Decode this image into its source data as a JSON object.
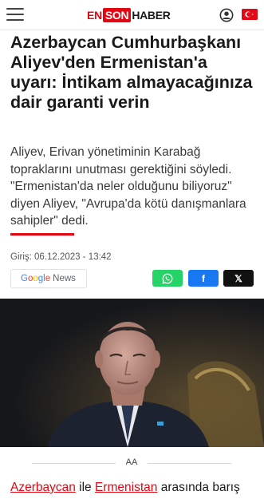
{
  "header": {
    "logo_en": "EN",
    "logo_son": "SON",
    "logo_haber": "HABER",
    "menu_icon": "hamburger-menu-icon",
    "user_icon": "user-account-icon",
    "flag_icon": "turkey-flag-icon"
  },
  "article": {
    "headline": "Azerbaycan Cumhurbaşkanı Aliyev'den Ermenistan'a uyarı: İntikam almayacağınıza dair garanti verin",
    "summary": "Aliyev, Erivan yönetiminin Karabağ topraklarını unutması gerektiğini söyledi. \"Ermenistan'da neler olduğunu biliyoruz\" diyen Aliyev, \"Avrupa'da kötü danışmanlara sahipler\" dedi.",
    "date": "Giriş: 06.12.2023 - 13:42",
    "google_news": {
      "g": "G",
      "o1": "o",
      "o2": "o",
      "g2": "g",
      "l": "l",
      "e": "e",
      "news": "News"
    },
    "share": {
      "whatsapp_icon": "whatsapp-icon",
      "facebook_label": "f",
      "x_label": "𝕏"
    },
    "source": "AA",
    "body_link1": "Azerbaycan",
    "body_mid1": " ile ",
    "body_link2": "Ermenistan",
    "body_rest": " arasında barış"
  },
  "colors": {
    "brand_red": "#e30613",
    "whatsapp": "#25d366",
    "facebook": "#1877f2"
  }
}
